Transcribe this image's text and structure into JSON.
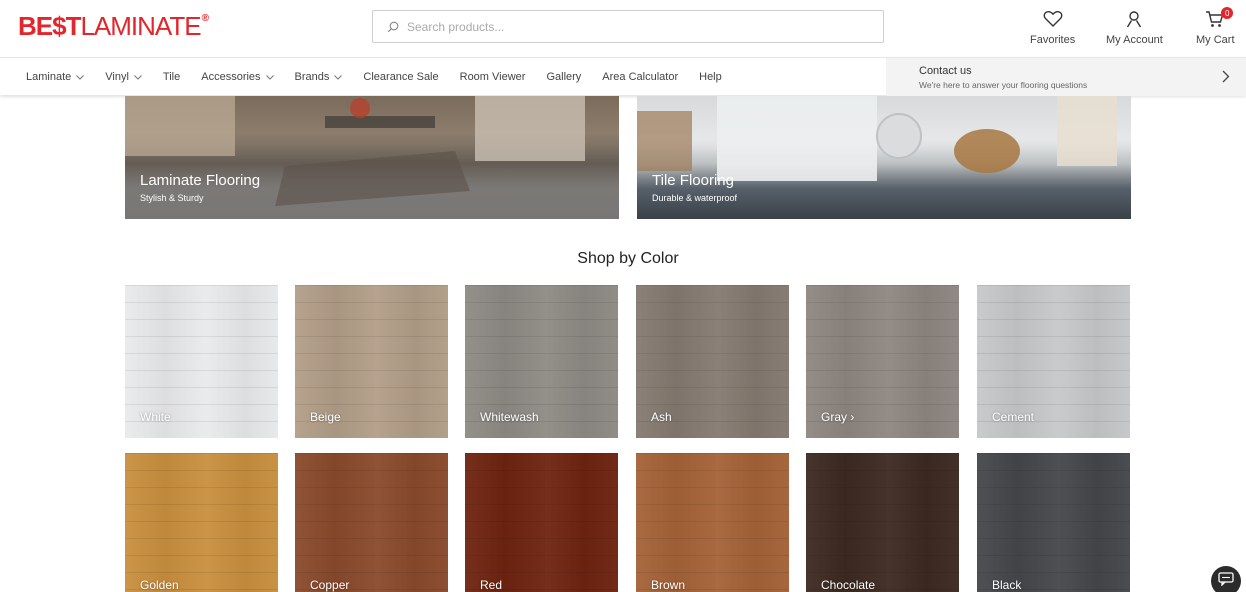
{
  "header": {
    "logo": {
      "part1": "BE$T",
      "part2": "LAMINATE",
      "reg": "®"
    },
    "search": {
      "placeholder": "Search products...",
      "value": ""
    },
    "actions": {
      "favorites": "Favorites",
      "account": "My Account",
      "cart": "My Cart",
      "cart_count": "0"
    }
  },
  "nav": {
    "items": [
      {
        "label": "Laminate",
        "dropdown": true
      },
      {
        "label": "Vinyl",
        "dropdown": true
      },
      {
        "label": "Tile",
        "dropdown": false
      },
      {
        "label": "Accessories",
        "dropdown": true
      },
      {
        "label": "Brands",
        "dropdown": true
      },
      {
        "label": "Clearance Sale",
        "dropdown": false
      },
      {
        "label": "Room Viewer",
        "dropdown": false
      },
      {
        "label": "Gallery",
        "dropdown": false
      },
      {
        "label": "Area Calculator",
        "dropdown": false
      },
      {
        "label": "Help",
        "dropdown": false
      }
    ],
    "contact": {
      "title": "Contact us",
      "subtitle": "We're here to answer your flooring questions"
    }
  },
  "banners": [
    {
      "title": "Laminate Flooring",
      "subtitle": "Stylish & Sturdy"
    },
    {
      "title": "Tile Flooring",
      "subtitle": "Durable & waterproof"
    }
  ],
  "shop_by_color": {
    "title": "Shop by Color",
    "swatches": [
      {
        "label": "White",
        "color": "#e9eaec"
      },
      {
        "label": "Beige",
        "color": "#b29e88"
      },
      {
        "label": "Whitewash",
        "color": "#8e8a84"
      },
      {
        "label": "Ash",
        "color": "#857a70"
      },
      {
        "label": "Gray ›",
        "color": "#8e8781"
      },
      {
        "label": "Cement",
        "color": "#c6c8ca"
      },
      {
        "label": "Golden",
        "color": "#c98f3e"
      },
      {
        "label": "Copper",
        "color": "#8a4a2c"
      },
      {
        "label": "Red",
        "color": "#6e2410"
      },
      {
        "label": "Brown",
        "color": "#a56238"
      },
      {
        "label": "Chocolate",
        "color": "#3d2a22"
      },
      {
        "label": "Black",
        "color": "#45474b"
      }
    ]
  },
  "colors": {
    "brand_red": "#e3262c"
  },
  "icons": [
    "search-icon",
    "heart-icon",
    "user-icon",
    "cart-icon",
    "chevron-down-icon",
    "chevron-right-icon",
    "chat-icon"
  ]
}
